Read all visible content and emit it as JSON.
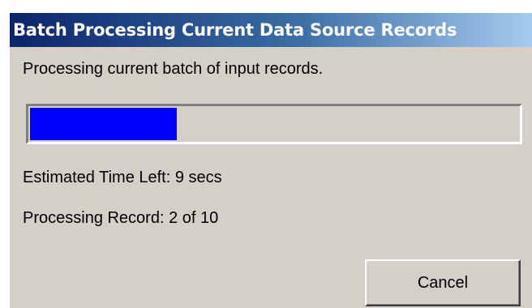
{
  "dialog": {
    "title": "Batch Processing Current Data Source Records",
    "message": "Processing current batch of input records.",
    "progress": {
      "fraction": 0.3,
      "color": "#0000ff"
    },
    "time_left_text": "Estimated Time Left: 9 secs",
    "record_text": "Processing Record: 2 of 10",
    "cancel_label": "Cancel"
  },
  "colors": {
    "titlebar_start": "#0a246a",
    "titlebar_end": "#a6caf0",
    "dialog_face": "#d4d0c8"
  }
}
